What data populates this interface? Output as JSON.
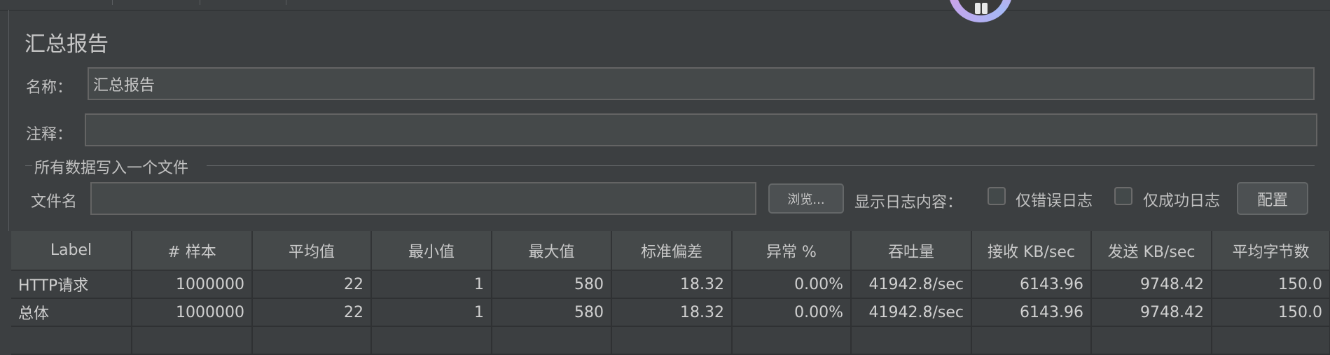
{
  "panel": {
    "title": "汇总报告",
    "name_label": "名称：",
    "name_value": "汇总报告",
    "comment_label": "注释：",
    "comment_value": ""
  },
  "file_group": {
    "title": "所有数据写入一个文件",
    "filename_label": "文件名",
    "filename_value": "",
    "browse_label": "浏览...",
    "log_display_label": "显示日志内容：",
    "errors_only_label": "仅错误日志",
    "errors_only_checked": false,
    "success_only_label": "仅成功日志",
    "success_only_checked": false,
    "config_label": "配置"
  },
  "table": {
    "columns": [
      "Label",
      "# 样本",
      "平均值",
      "最小值",
      "最大值",
      "标准偏差",
      "异常 %",
      "吞吐量",
      "接收 KB/sec",
      "发送 KB/sec",
      "平均字节数"
    ],
    "rows": [
      [
        "HTTP请求",
        "1000000",
        "22",
        "1",
        "580",
        "18.32",
        "0.00%",
        "41942.8/sec",
        "6143.96",
        "9748.42",
        "150.0"
      ],
      [
        "总体",
        "1000000",
        "22",
        "1",
        "580",
        "18.32",
        "0.00%",
        "41942.8/sec",
        "6143.96",
        "9748.42",
        "150.0"
      ]
    ]
  },
  "icons": {
    "avatar": "user-avatar-icon"
  },
  "colors": {
    "background": "#3c3f41",
    "field_background": "#45494a",
    "header_background": "#45494a",
    "text": "#bbbbbb"
  }
}
